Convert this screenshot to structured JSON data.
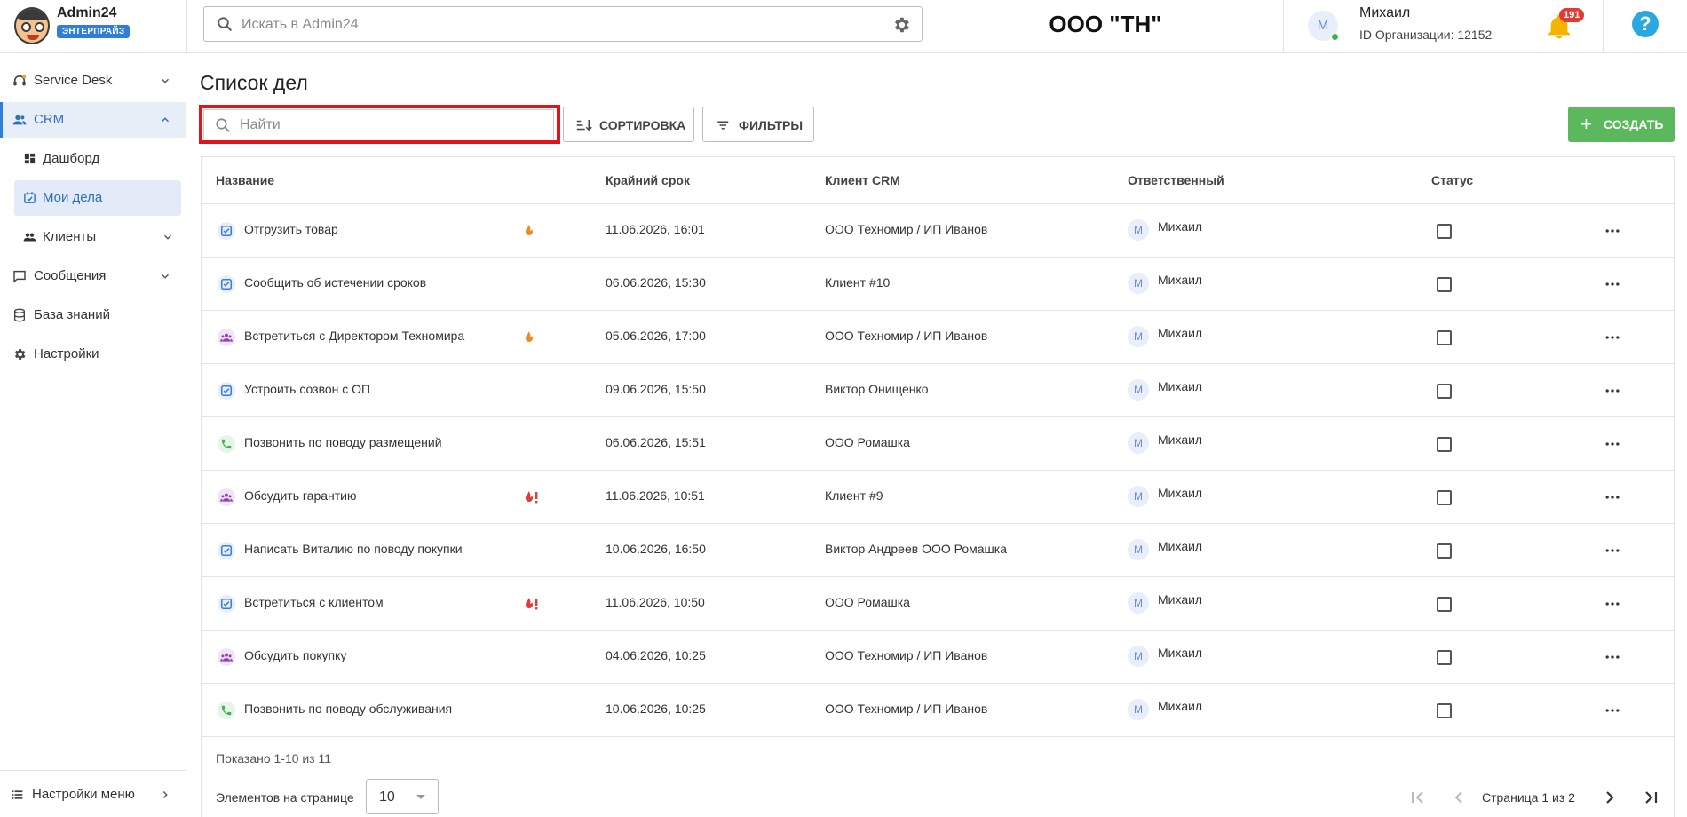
{
  "app": {
    "name": "Admin24",
    "edition": "ЭНТЕРПРАЙЗ"
  },
  "header": {
    "search_placeholder": "Искать в Admin24",
    "org_title": "ООО \"ТН\"",
    "user": {
      "avatar_letter": "М",
      "name": "Михаил",
      "org_id": "ID Организации: 12152"
    },
    "notifications_count": "191",
    "help_label": "?"
  },
  "sidebar": {
    "items": [
      {
        "label": "Service Desk",
        "icon": "headset-icon"
      },
      {
        "label": "CRM",
        "icon": "users-icon"
      },
      {
        "label": "Дашборд",
        "icon": "dashboard-icon"
      },
      {
        "label": "Мои дела",
        "icon": "calendar-check-icon"
      },
      {
        "label": "Клиенты",
        "icon": "clients-icon"
      },
      {
        "label": "Сообщения",
        "icon": "message-icon"
      },
      {
        "label": "База знаний",
        "icon": "database-icon"
      },
      {
        "label": "Настройки",
        "icon": "gear-icon"
      }
    ],
    "bottom_label": "Настройки меню"
  },
  "main": {
    "title": "Список дел",
    "search_placeholder": "Найти",
    "sort_label": "СОРТИРОВКА",
    "filter_label": "ФИЛЬТРЫ",
    "create_label": "СОЗДАТЬ",
    "columns": [
      "Название",
      "Крайний срок",
      "Клиент CRM",
      "Ответственный",
      "Статус"
    ],
    "rows": [
      {
        "type": "task",
        "name": "Отгрузить товар",
        "priority": "hot",
        "deadline": "11.06.2026, 16:01",
        "client": "ООО Техномир / ИП Иванов",
        "resp_letter": "М",
        "responsible": "Михаил"
      },
      {
        "type": "task",
        "name": "Сообщить об истечении сроков",
        "priority": "none",
        "deadline": "06.06.2026, 15:30",
        "client": "Клиент #10",
        "resp_letter": "М",
        "responsible": "Михаил"
      },
      {
        "type": "meet",
        "name": "Встретиться с Директором Техномира",
        "priority": "hot",
        "deadline": "05.06.2026, 17:00",
        "client": "ООО Техномир / ИП Иванов",
        "resp_letter": "М",
        "responsible": "Михаил"
      },
      {
        "type": "task",
        "name": "Устроить созвон с ОП",
        "priority": "none",
        "deadline": "09.06.2026, 15:50",
        "client": "Виктор Онищенко",
        "resp_letter": "М",
        "responsible": "Михаил"
      },
      {
        "type": "call",
        "name": "Позвонить по поводу размещений",
        "priority": "none",
        "deadline": "06.06.2026, 15:51",
        "client": "ООО Ромашка",
        "resp_letter": "М",
        "responsible": "Михаил"
      },
      {
        "type": "meet",
        "name": "Обсудить гарантию",
        "priority": "urgent",
        "deadline": "11.06.2026, 10:51",
        "client": "Клиент #9",
        "resp_letter": "М",
        "responsible": "Михаил"
      },
      {
        "type": "task",
        "name": "Написать Виталию по поводу покупки",
        "priority": "none",
        "deadline": "10.06.2026, 16:50",
        "client": "Виктор Андреев ООО Ромашка",
        "resp_letter": "М",
        "responsible": "Михаил"
      },
      {
        "type": "task",
        "name": "Встретиться с клиентом",
        "priority": "urgent",
        "deadline": "11.06.2026, 10:50",
        "client": "ООО Ромашка",
        "resp_letter": "М",
        "responsible": "Михаил"
      },
      {
        "type": "meet",
        "name": "Обсудить покупку",
        "priority": "none",
        "deadline": "04.06.2026, 10:25",
        "client": "ООО Техномир / ИП Иванов",
        "resp_letter": "М",
        "responsible": "Михаил"
      },
      {
        "type": "call",
        "name": "Позвонить по поводу обслуживания",
        "priority": "none",
        "deadline": "10.06.2026, 10:25",
        "client": "ООО Техномир / ИП Иванов",
        "resp_letter": "М",
        "responsible": "Михаил"
      }
    ],
    "footer": {
      "shown": "Показано 1-10 из 11",
      "per_page_label": "Элементов на странице",
      "per_page_value": "10",
      "page_label": "Страница 1 из 2"
    }
  },
  "colors": {
    "accent": "#2f7fd8",
    "create_button": "#5cb85c",
    "search_highlight": "#e0141a",
    "badge": "#e53935",
    "fire": "#f08a24",
    "fire_urgent": "#e53935"
  }
}
